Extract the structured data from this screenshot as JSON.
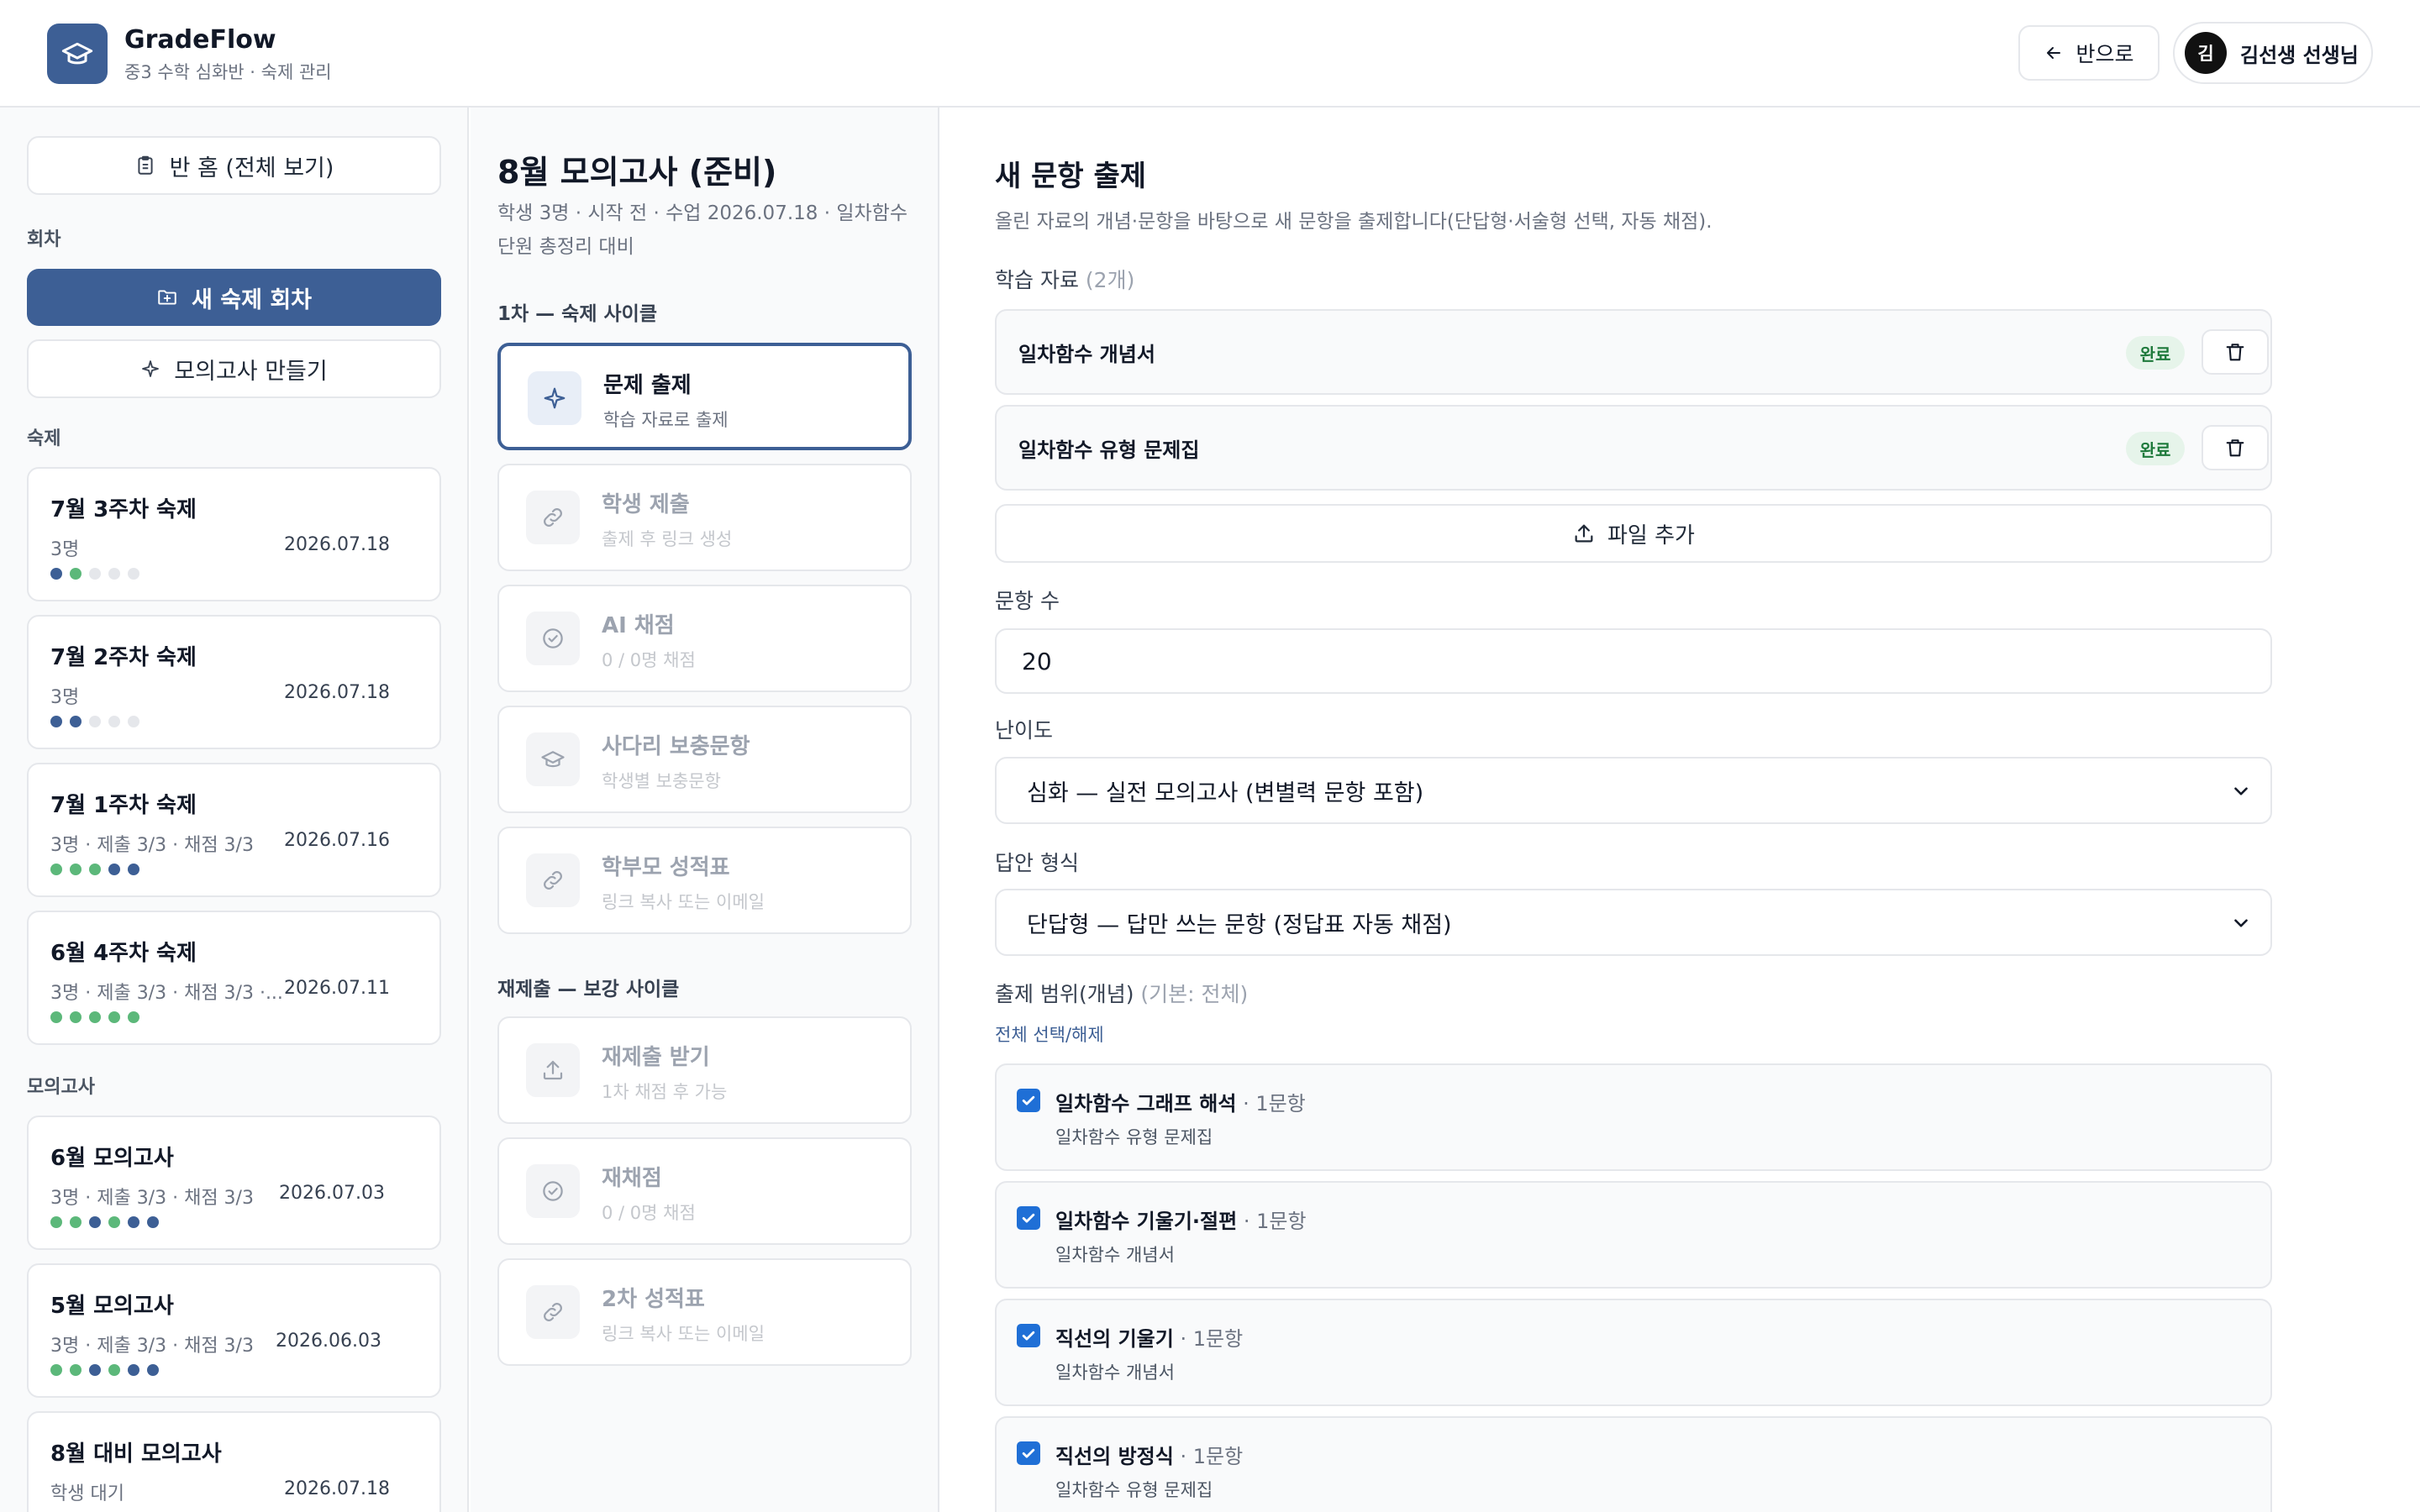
{
  "header": {
    "app_name": "GradeFlow",
    "app_subtitle": "중3 수학 심화반 · 숙제 관리",
    "back_label": "반으로",
    "avatar_initial": "김",
    "user_name": "김선생 선생님"
  },
  "sidebar": {
    "home_label": "반 홈 (전체 보기)",
    "rounds_label": "회차",
    "new_round_label": "새 숙제 회차",
    "make_mock_label": "모의고사 만들기",
    "homework_label": "숙제",
    "mock_label": "모의고사",
    "homework": [
      {
        "title": "7월 3주차 숙제",
        "meta": "3명",
        "date": "2026.07.18",
        "dots": [
          "blue",
          "green",
          "gray",
          "gray",
          "gray"
        ]
      },
      {
        "title": "7월 2주차 숙제",
        "meta": "3명",
        "date": "2026.07.18",
        "dots": [
          "blue",
          "blue",
          "gray",
          "gray",
          "gray"
        ]
      },
      {
        "title": "7월 1주차 숙제",
        "meta": "3명 · 제출 3/3 · 채점 3/3",
        "date": "2026.07.16",
        "dots": [
          "green",
          "green",
          "green",
          "blue",
          "blue"
        ]
      },
      {
        "title": "6월 4주차 숙제",
        "meta": "3명 · 제출 3/3 · 채점 3/3 ·...",
        "date": "2026.07.11",
        "dots": [
          "green",
          "green",
          "green",
          "green",
          "green"
        ]
      }
    ],
    "mocks": [
      {
        "title": "6월 모의고사",
        "meta": "3명 · 제출 3/3 · 채점 3/3",
        "date": "2026.07.03",
        "dots": [
          "green",
          "green",
          "blue",
          "green",
          "blue",
          "blue"
        ]
      },
      {
        "title": "5월 모의고사",
        "meta": "3명 · 제출 3/3 · 채점 3/3",
        "date": "2026.06.03",
        "dots": [
          "green",
          "green",
          "blue",
          "green",
          "blue",
          "blue"
        ]
      },
      {
        "title": "8월 대비 모의고사",
        "meta": "학생 대기",
        "date": "2026.07.18",
        "dots": []
      }
    ]
  },
  "middle": {
    "title": "8월 모의고사 (준비)",
    "subtitle": "학생 3명 · 시작 전 · 수업 2026.07.18 · 일차함수 단원 총정리 대비",
    "section1": "1차 — 숙제 사이클",
    "section2": "재제출 — 보강 사이클",
    "steps1": [
      {
        "title": "문제 출제",
        "sub": "학습 자료로 출제",
        "icon": "sparkle"
      },
      {
        "title": "학생 제출",
        "sub": "출제 후 링크 생성",
        "icon": "link"
      },
      {
        "title": "AI 채점",
        "sub": "0 / 0명 채점",
        "icon": "check"
      },
      {
        "title": "사다리 보충문항",
        "sub": "학생별 보충문항",
        "icon": "cap"
      },
      {
        "title": "학부모 성적표",
        "sub": "링크 복사 또는 이메일",
        "icon": "link"
      }
    ],
    "steps2": [
      {
        "title": "재제출 받기",
        "sub": "1차 채점 후 가능",
        "icon": "upload"
      },
      {
        "title": "재채점",
        "sub": "0 / 0명 채점",
        "icon": "check"
      },
      {
        "title": "2차 성적표",
        "sub": "링크 복사 또는 이메일",
        "icon": "link"
      }
    ]
  },
  "main": {
    "title": "새 문항 출제",
    "description": "올린 자료의 개념·문항을 바탕으로 새 문항을 출제합니다(단답형·서술형 선택, 자동 채점).",
    "materials_label": "학습 자료",
    "materials_count": "(2개)",
    "materials": [
      {
        "name": "일차함수 개념서",
        "status": "완료"
      },
      {
        "name": "일차함수 유형 문제집",
        "status": "완료"
      }
    ],
    "add_file_label": "파일 추가",
    "count_label": "문항 수",
    "count_value": "20",
    "difficulty_label": "난이도",
    "difficulty_value": "심화 — 실전 모의고사 (변별력 문항 포함)",
    "answer_label": "답안 형식",
    "answer_value": "단답형 — 답만 쓰는 문항 (정답표 자동 채점)",
    "scope_label": "출제 범위(개념)",
    "scope_default": "(기본: 전체)",
    "toggle_all_label": "전체 선택/해제",
    "concepts": [
      {
        "name": "일차함수 그래프 해석",
        "count": "· 1문항",
        "source": "일차함수 유형 문제집"
      },
      {
        "name": "일차함수 기울기·절편",
        "count": "· 1문항",
        "source": "일차함수 개념서"
      },
      {
        "name": "직선의 기울기",
        "count": "· 1문항",
        "source": "일차함수 개념서"
      },
      {
        "name": "직선의 방정식",
        "count": "· 1문항",
        "source": "일차함수 유형 문제집"
      }
    ]
  }
}
